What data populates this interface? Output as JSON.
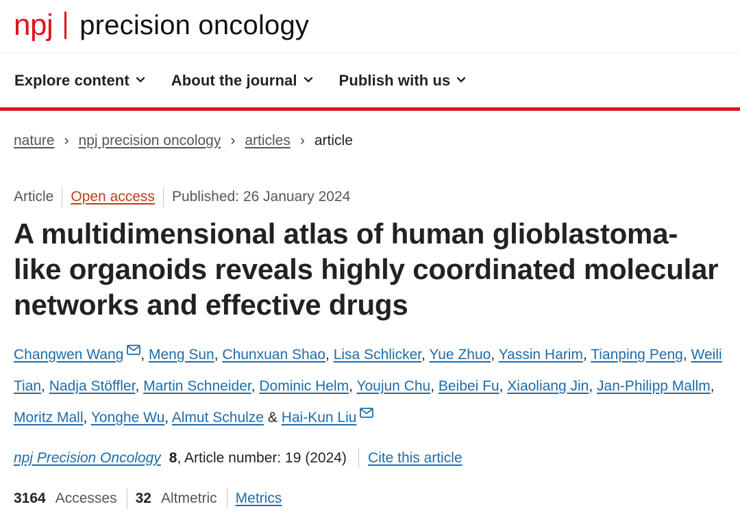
{
  "header": {
    "brand_short": "npj",
    "brand_name": "precision oncology"
  },
  "nav": {
    "items": [
      {
        "label": "Explore content"
      },
      {
        "label": "About the journal"
      },
      {
        "label": "Publish with us"
      }
    ]
  },
  "breadcrumb": {
    "items": [
      "nature",
      "npj precision oncology",
      "articles"
    ],
    "current": "article",
    "separator": "›"
  },
  "meta": {
    "type": "Article",
    "access": "Open access",
    "published": "Published: 26 January 2024"
  },
  "article": {
    "title_lines": [
      "A multidimensional atlas of human glioblastoma-",
      "like organoids reveals highly coordinated molecular",
      "networks and effective drugs"
    ]
  },
  "authors": [
    {
      "name": "Changwen Wang",
      "corresponding": true
    },
    {
      "name": "Meng Sun"
    },
    {
      "name": "Chunxuan Shao"
    },
    {
      "name": "Lisa Schlicker"
    },
    {
      "name": "Yue Zhuo"
    },
    {
      "name": "Yassin Harim"
    },
    {
      "name": "Tianping Peng"
    },
    {
      "name": "Weili Tian"
    },
    {
      "name": "Nadja Stöffler"
    },
    {
      "name": "Martin Schneider"
    },
    {
      "name": "Dominic Helm"
    },
    {
      "name": "Youjun Chu"
    },
    {
      "name": "Beibei Fu"
    },
    {
      "name": "Xiaoliang Jin"
    },
    {
      "name": "Jan-Philipp Mallm"
    },
    {
      "name": "Moritz Mall"
    },
    {
      "name": "Yonghe Wu"
    },
    {
      "name": "Almut Schulze"
    },
    {
      "name": "Hai-Kun Liu",
      "corresponding": true
    }
  ],
  "author_separators": {
    "comma": ", ",
    "ampersand": " & "
  },
  "citation": {
    "journal": "npj Precision Oncology",
    "volume": "8",
    "article_number": ", Article number: 19 (2024)",
    "cite_label": "Cite this article"
  },
  "metrics": {
    "accesses_value": "3164",
    "accesses_label": "Accesses",
    "altmetric_value": "32",
    "altmetric_label": "Altmetric",
    "metrics_link": "Metrics"
  },
  "colors": {
    "brand_red": "#e0121b",
    "link_blue": "#1e6ba8",
    "open_access_orange": "#c4391d"
  },
  "icons": {
    "nav_dropdown": "chevron-down-icon",
    "breadcrumb_separator": "chevron-right-icon",
    "corresponding_author": "mail-icon"
  }
}
